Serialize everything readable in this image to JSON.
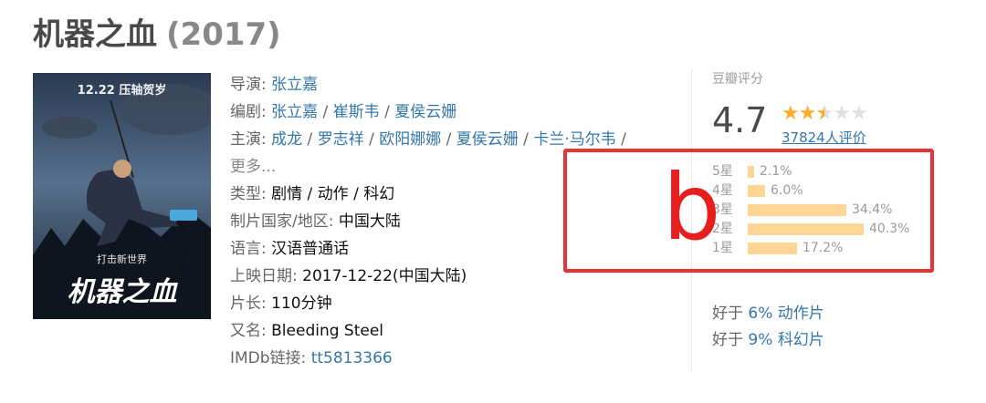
{
  "movie": {
    "title": "机器之血",
    "year": "(2017)"
  },
  "poster": {
    "top_text": "12.22 压轴贺岁",
    "slogan": "打击新世界",
    "logo_text": "机器之血"
  },
  "info": {
    "director_label": "导演:",
    "director": "张立嘉",
    "writer_label": "编剧:",
    "writers": [
      "张立嘉",
      "崔斯韦",
      "夏侯云姗"
    ],
    "cast_label": "主演:",
    "cast": [
      "成龙",
      "罗志祥",
      "欧阳娜娜",
      "夏侯云姗",
      "卡兰·马尔韦"
    ],
    "more_label": "更多...",
    "genre_label": "类型:",
    "genres": [
      "剧情",
      "动作",
      "科幻"
    ],
    "country_label": "制片国家/地区:",
    "country": "中国大陆",
    "language_label": "语言:",
    "language": "汉语普通话",
    "release_label": "上映日期:",
    "release": "2017-12-22(中国大陆)",
    "runtime_label": "片长:",
    "runtime": "110分钟",
    "aka_label": "又名:",
    "aka": "Bleeding Steel",
    "imdb_label": "IMDb链接:",
    "imdb": "tt5813366"
  },
  "rating": {
    "header": "豆瓣评分",
    "score": "4.7",
    "stars": 2.5,
    "votes": "37824人评价",
    "distribution": [
      {
        "label": "5星",
        "percent": 2.1,
        "text": "2.1%"
      },
      {
        "label": "4星",
        "percent": 6.0,
        "text": "6.0%"
      },
      {
        "label": "3星",
        "percent": 34.4,
        "text": "34.4%"
      },
      {
        "label": "2星",
        "percent": 40.3,
        "text": "40.3%"
      },
      {
        "label": "1星",
        "percent": 17.2,
        "text": "17.2%"
      }
    ]
  },
  "annotation": {
    "mark": "b",
    "color": "#e63333"
  },
  "better_than": [
    {
      "prefix": "好于",
      "value": "6% 动作片"
    },
    {
      "prefix": "好于",
      "value": "9% 科幻片"
    }
  ],
  "colors": {
    "link": "#3377aa",
    "star": "#ffac2d",
    "bar": "#ffd596",
    "title": "#494949"
  }
}
